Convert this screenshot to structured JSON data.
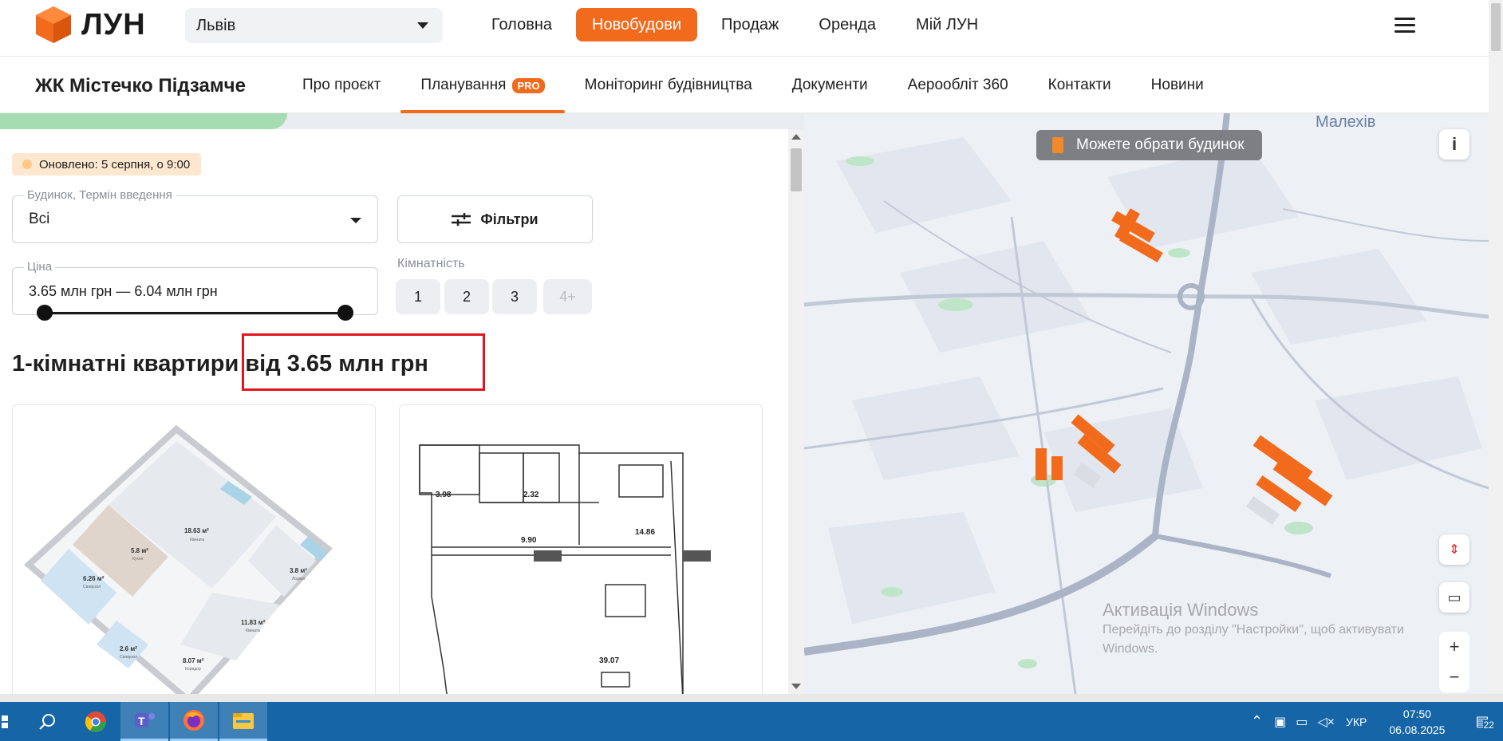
{
  "header": {
    "logo_text": "ЛУН",
    "city": "Львів",
    "nav": [
      {
        "label": "Головна",
        "active": false
      },
      {
        "label": "Новобудови",
        "active": true
      },
      {
        "label": "Продаж",
        "active": false
      },
      {
        "label": "Оренда",
        "active": false
      },
      {
        "label": "Мій ЛУН",
        "active": false
      }
    ]
  },
  "subheader": {
    "project_title": "ЖК Містечко Підзамче",
    "tabs": [
      {
        "label": "Про проєкт",
        "active": false
      },
      {
        "label": "Планування",
        "active": true,
        "badge": "PRO"
      },
      {
        "label": "Моніторинг будівництва",
        "active": false
      },
      {
        "label": "Документи",
        "active": false
      },
      {
        "label": "Аерооблiт 360",
        "active": false
      },
      {
        "label": "Контакти",
        "active": false
      },
      {
        "label": "Новини",
        "active": false
      }
    ]
  },
  "filters": {
    "updated": "Оновлено: 5 серпня, о 9:00",
    "building_label": "Будинок, Термін введення",
    "building_value": "Всі",
    "filters_button": "Фільтри",
    "price_label": "Ціна",
    "price_value": "3.65 млн грн — 6.04 млн грн",
    "rooms_label": "Кімнатність",
    "rooms": [
      "1",
      "2",
      "3",
      "4+"
    ]
  },
  "listing": {
    "heading_prefix": "1-кімнатні квартири",
    "heading_price": "від 3.65 млн грн",
    "plan1": {
      "rooms": [
        "18.63 м²",
        "5.8 м²",
        "6.26 м²",
        "3.8 м²",
        "11.83 м²",
        "2.6 м²",
        "8.07 м²"
      ],
      "names": [
        "Кімната",
        "Кухня",
        "Санвузол",
        "Лоджія",
        "Кімната",
        "Санвузол",
        "Коридор"
      ]
    },
    "plan2": {
      "areas": [
        "3.98",
        "2.32",
        "14.86",
        "9.90",
        "39.07"
      ]
    }
  },
  "map": {
    "pill": "Можете обрати будинок",
    "place_label": "Малехів",
    "watermark_title": "Активація Windows",
    "watermark_line1": "Перейдіть до розділу \"Настройки\", щоб активувати",
    "watermark_line2": "Windows."
  },
  "taskbar": {
    "language": "УКР",
    "time": "07:50",
    "date": "06.08.2025",
    "notifications": "22"
  },
  "colors": {
    "accent": "#f26a1b",
    "taskbar": "#1565a7",
    "highlight": "#e4141c"
  }
}
